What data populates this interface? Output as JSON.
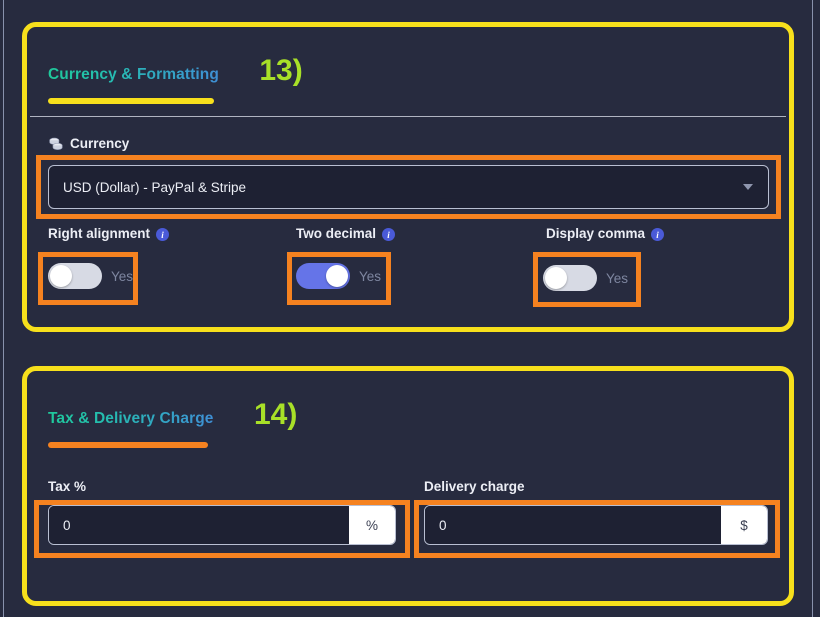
{
  "page": {
    "background": "#272b3f",
    "annotation_box_color": "#f7e01c",
    "highlight_box_color": "#f58220",
    "annotation_number_color": "#a8e028",
    "toggle_on_color": "#6574e8",
    "toggle_off_color": "#d7dae4"
  },
  "sections": [
    {
      "title": "Currency & Formatting",
      "annotation": "13)",
      "underline_color": "#f7e01c",
      "currency": {
        "label": "Currency",
        "icon": "coins-icon",
        "selected": "USD (Dollar) - PayPal & Stripe",
        "caret": "chevron-down-icon"
      },
      "toggles": [
        {
          "label": "Right alignment",
          "info": "i",
          "state": "off",
          "state_text": "Yes"
        },
        {
          "label": "Two decimal",
          "info": "i",
          "state": "on",
          "state_text": "Yes"
        },
        {
          "label": "Display comma",
          "info": "i",
          "state": "off",
          "state_text": "Yes"
        }
      ]
    },
    {
      "title": "Tax & Delivery Charge",
      "annotation": "14)",
      "underline_color": "#f58220",
      "fields": [
        {
          "label": "Tax %",
          "value": "0",
          "addon": "%"
        },
        {
          "label": "Delivery charge",
          "value": "0",
          "addon": "$"
        }
      ]
    }
  ]
}
